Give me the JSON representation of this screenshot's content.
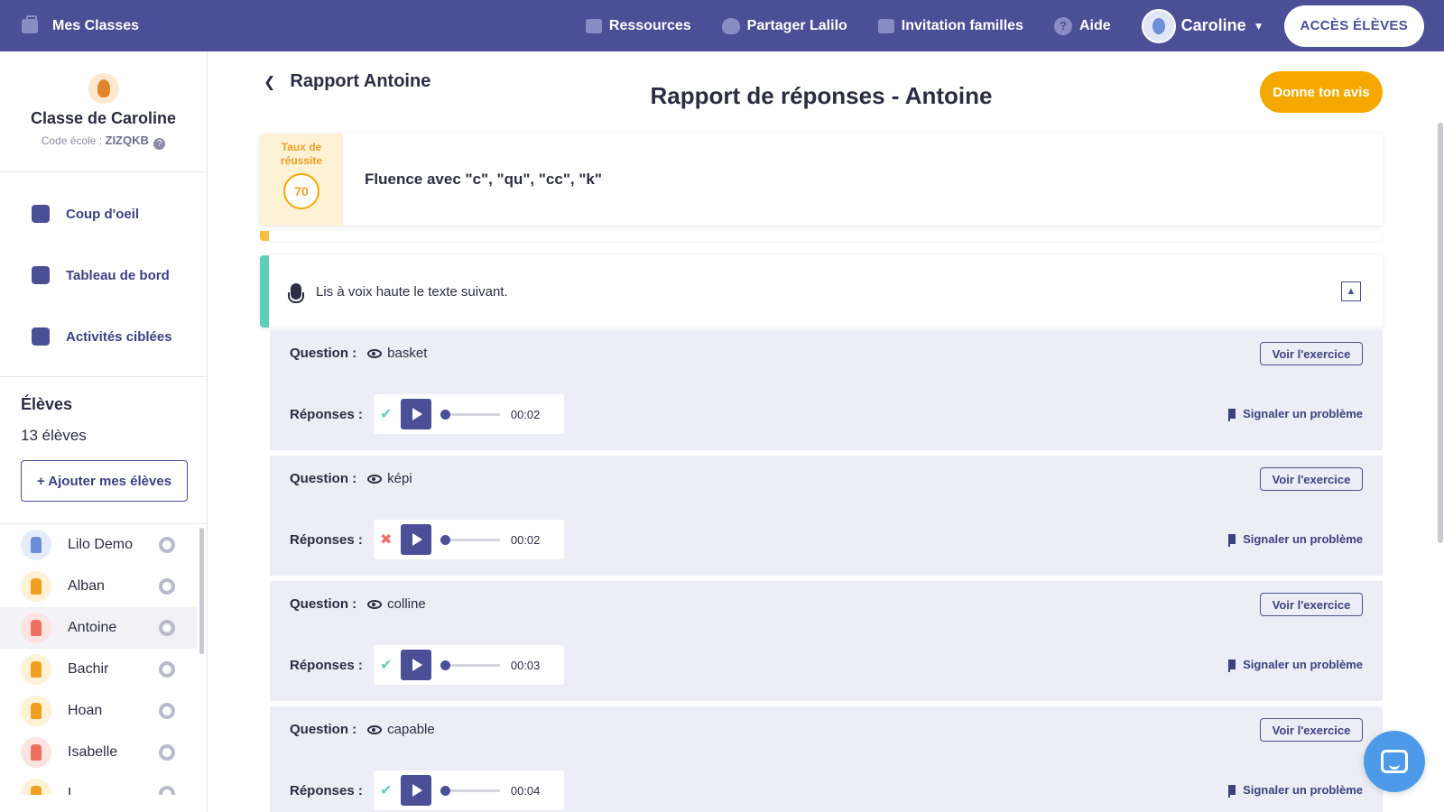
{
  "topbar": {
    "brand": "Mes Classes",
    "nav": [
      {
        "label": "Ressources",
        "icon": "folder-icon"
      },
      {
        "label": "Partager Lalilo",
        "icon": "heart-icon"
      },
      {
        "label": "Invitation familles",
        "icon": "envelope-icon"
      },
      {
        "label": "Aide",
        "icon": "help-icon"
      }
    ],
    "user": "Caroline",
    "acces_label": "ACCÈS ÉLÈVES"
  },
  "sidebar": {
    "class_title": "Classe de Caroline",
    "code_label": "Code école :",
    "code_value": "ZIZQKB",
    "menu": [
      {
        "label": "Coup d'oeil",
        "icon": "chart-icon"
      },
      {
        "label": "Tableau de bord",
        "icon": "dashboard-icon"
      },
      {
        "label": "Activités ciblées",
        "icon": "document-icon"
      }
    ],
    "eleves_title": "Élèves",
    "eleves_count": "13 élèves",
    "add_label": "+ Ajouter mes élèves",
    "students": [
      {
        "name": "Lilo Demo",
        "color": "#6a8fd6",
        "bg": "#e4ecfa"
      },
      {
        "name": "Alban",
        "color": "#f0a020",
        "bg": "#fdf1d6"
      },
      {
        "name": "Antoine",
        "color": "#f07060",
        "bg": "#fde4e0"
      },
      {
        "name": "Bachir",
        "color": "#f0a020",
        "bg": "#fdf1d6"
      },
      {
        "name": "Hoan",
        "color": "#f0a020",
        "bg": "#fdf1d6"
      },
      {
        "name": "Isabelle",
        "color": "#f07060",
        "bg": "#fde4e0"
      },
      {
        "name": "L...",
        "color": "#f0a020",
        "bg": "#fdf1d6"
      }
    ]
  },
  "main": {
    "back_label": "Rapport Antoine",
    "title": "Rapport de réponses - Antoine",
    "avis_label": "Donne ton avis",
    "summary": {
      "rate_label": "Taux de réussite",
      "rate_value": "70",
      "activity": "Fluence avec \"c\", \"qu\", \"cc\", \"k\""
    },
    "instruction": "Lis à voix haute le texte suivant.",
    "question_label": "Question :",
    "responses_label": "Réponses :",
    "voir_label": "Voir l'exercice",
    "signal_label": "Signaler un problème",
    "questions": [
      {
        "word": "basket",
        "result": "ok",
        "time": "00:02"
      },
      {
        "word": "képi",
        "result": "ko",
        "time": "00:02"
      },
      {
        "word": "colline",
        "result": "ok",
        "time": "00:03"
      },
      {
        "word": "capable",
        "result": "ok",
        "time": "00:04"
      }
    ]
  }
}
